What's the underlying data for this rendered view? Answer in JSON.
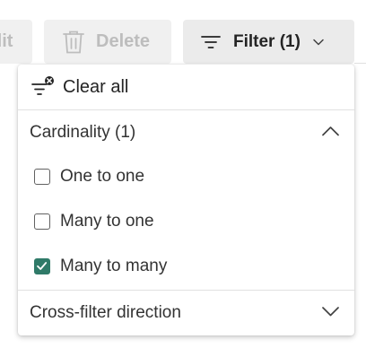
{
  "toolbar": {
    "edit_label": "dit",
    "delete_label": "Delete",
    "filter_label": "Filter (1)",
    "left_fragment": ")"
  },
  "dropdown": {
    "clear_all_label": "Clear all",
    "sections": [
      {
        "label": "Cardinality (1)",
        "expanded": true,
        "options": [
          {
            "label": "One to one",
            "checked": false
          },
          {
            "label": "Many to one",
            "checked": false
          },
          {
            "label": "Many to many",
            "checked": true
          }
        ]
      },
      {
        "label": "Cross-filter direction",
        "expanded": false
      }
    ]
  },
  "colors": {
    "accent": "#2f7a68",
    "disabled_text": "#bdbdbd",
    "disabled_bg": "#f0f0f0",
    "filter_bg": "#ebebeb"
  },
  "icons": {
    "delete": "trash-icon",
    "filter": "filter-lines-icon",
    "filter_chevron": "chevron-down-icon",
    "clear_all": "filter-clear-icon",
    "section_expanded": "chevron-up-icon",
    "section_collapsed": "chevron-down-icon",
    "checkmark": "checkmark-icon"
  }
}
